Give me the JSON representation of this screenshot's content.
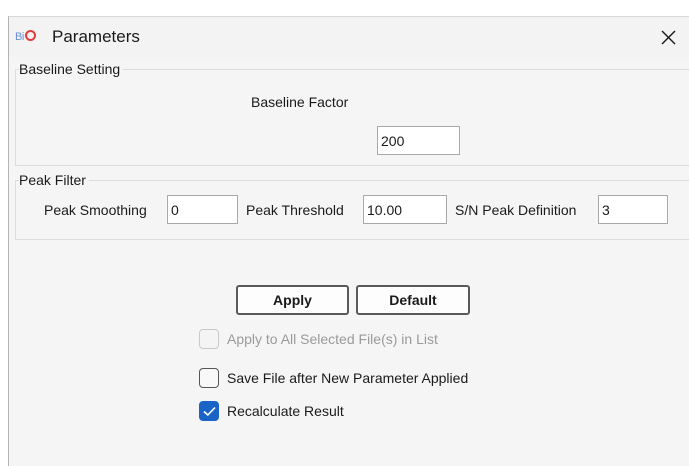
{
  "window": {
    "icon_text": "Bi",
    "title": "Parameters"
  },
  "baseline": {
    "group_label": "Baseline Setting",
    "factor_label": "Baseline Factor",
    "factor_value": "200"
  },
  "peak_filter": {
    "group_label": "Peak Filter",
    "smoothing_label": "Peak Smoothing",
    "smoothing_value": "0",
    "threshold_label": "Peak Threshold",
    "threshold_value": "10.00",
    "sn_label": "S/N Peak Definition",
    "sn_value": "3"
  },
  "buttons": {
    "apply_label": "Apply",
    "default_label": "Default"
  },
  "options": {
    "apply_all_label": "Apply to All Selected File(s) in List",
    "apply_all_checked": false,
    "apply_all_enabled": false,
    "save_file_label": "Save File after New Parameter Applied",
    "save_file_checked": false,
    "recalculate_label": "Recalculate Result",
    "recalculate_checked": true
  },
  "colors": {
    "checkbox_checked": "#1a64c8",
    "icon_blue": "#6a8fd6",
    "icon_red": "#e23d3d"
  },
  "icons": {
    "app": "bio-logo-icon",
    "close": "close-icon",
    "check": "checkmark-icon"
  }
}
